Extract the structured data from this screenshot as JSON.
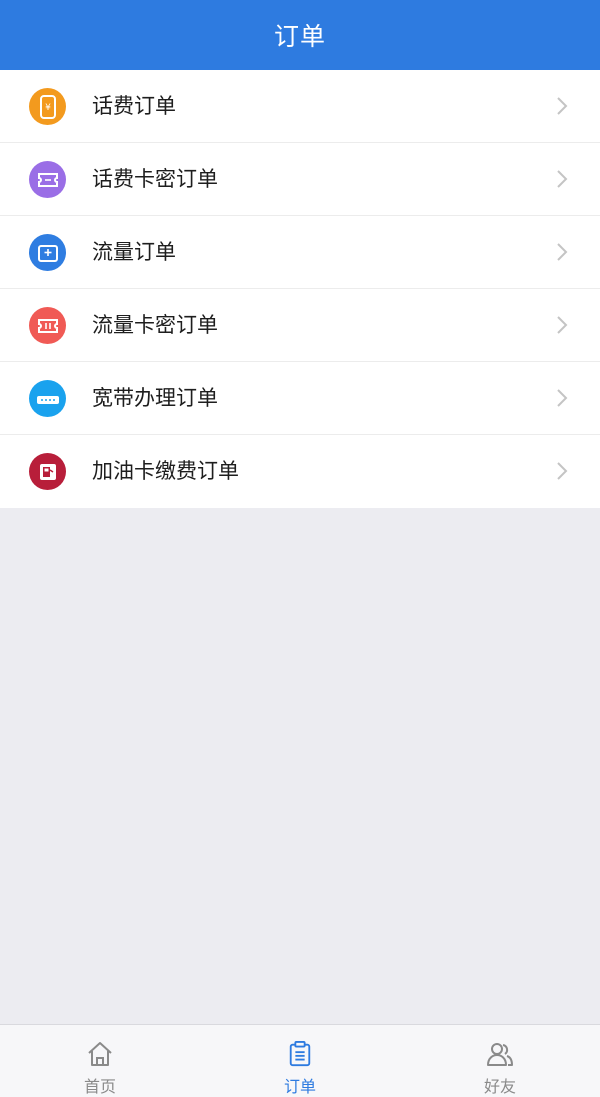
{
  "header": {
    "title": "订单"
  },
  "orders": [
    {
      "label": "话费订单",
      "icon": "phone-bill-icon",
      "color": "#f39a1e"
    },
    {
      "label": "话费卡密订单",
      "icon": "phone-card-icon",
      "color": "#9a6ee6"
    },
    {
      "label": "流量订单",
      "icon": "data-traffic-icon",
      "color": "#2f7de1"
    },
    {
      "label": "流量卡密订单",
      "icon": "data-card-icon",
      "color": "#f05a55"
    },
    {
      "label": "宽带办理订单",
      "icon": "router-icon",
      "color": "#1aa2ee"
    },
    {
      "label": "加油卡缴费订单",
      "icon": "fuel-card-icon",
      "color": "#b81e3a"
    }
  ],
  "tabbar": {
    "tabs": [
      {
        "label": "首页",
        "icon": "home-icon",
        "active": false
      },
      {
        "label": "订单",
        "icon": "clipboard-icon",
        "active": true
      },
      {
        "label": "好友",
        "icon": "friends-icon",
        "active": false
      }
    ],
    "active_color": "#2e7be0",
    "inactive_color": "#8a8a8a"
  },
  "colors": {
    "header_bg": "#2e7be0",
    "page_bg": "#ececf1"
  }
}
